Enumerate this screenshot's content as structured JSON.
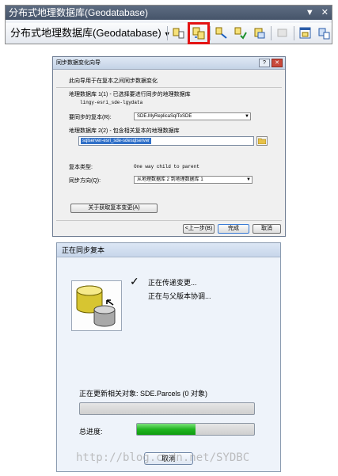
{
  "toolbar": {
    "title": "分布式地理数据库(Geodatabase)",
    "title_buttons": [
      "▼",
      "✕"
    ],
    "dropdown_label": "分布式地理数据库(Geodatabase)",
    "buttons": [
      {
        "name": "create-checkout-icon",
        "highlighted": false
      },
      {
        "name": "synchronize-changes-icon",
        "highlighted": true
      },
      {
        "name": "extract-data-icon",
        "highlighted": false
      },
      {
        "name": "check-in-icon",
        "highlighted": false
      },
      {
        "name": "export-changes-icon",
        "highlighted": false
      },
      {
        "name": "import-message-icon",
        "highlighted": false
      },
      {
        "name": "manage-replicas-icon",
        "highlighted": false
      },
      {
        "name": "replica-manager-icon",
        "highlighted": false
      }
    ]
  },
  "wizard": {
    "title": "同步数据变化向导",
    "title_buttons": [
      "?",
      "✕"
    ],
    "description": "此向导用于在复本之间同步数据变化",
    "gdb1_label": "地理数据库 1(1) - 已选择要进行同步的地理数据库",
    "gdb1_value": "lingy-esri_sde-lgydata",
    "replica_label": "要同步的复本(R):",
    "replica_value": "SDE.MyReplicaSqlToSDE",
    "gdb2_label": "地理数据库 2(2) - 包含相关复本的地理数据库",
    "gdb2_value": "sqlserver-esri_sde-sdesqlserver",
    "replica_type_label": "复本类型:",
    "replica_type_value": "One way child to parent",
    "direction_label": "同步方向(Q):",
    "direction_value": "从地理数据库 2 到地理数据库 1",
    "about_button": "关于获取复本变更(A)",
    "back_button": "<上一步(B)",
    "finish_button": "完成",
    "cancel_button": "取消"
  },
  "sync": {
    "title": "正在同步复本",
    "step1": "正在传递变更...",
    "step2": "正在与父版本协调...",
    "status": "正在更新相关对象: SDE.Parcels (0 对象)",
    "item_progress": 0,
    "total_label": "总进度:",
    "total_progress": 0.5,
    "cancel_button": "取消"
  },
  "watermark": "http://blog.csdn.net/SYDBC",
  "colors": {
    "highlight": "#e31313",
    "progress_green": "#21b521",
    "selection_blue": "#3070c8"
  }
}
